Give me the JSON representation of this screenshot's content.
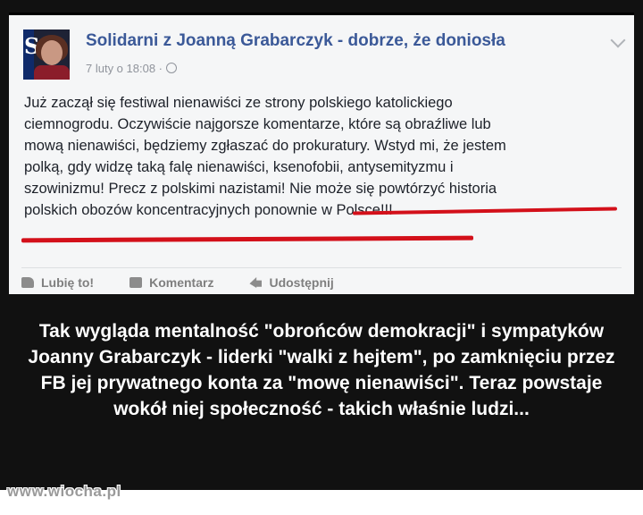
{
  "post": {
    "page_name": "Solidarni z Joanną Grabarczyk - dobrze, że doniosła",
    "timestamp": "7 lutу o 18:08 ·",
    "lines": [
      "Już zaczął się festiwal nienawiści ze strony polskiego katolickiego",
      "ciemnogrodu. Oczywiście najgorsze komentarze, które są obraźliwe lub",
      "mową nienawiści, będziemy zgłaszać do prokuratury. Wstyd mi, że jestem",
      "polką, gdy widzę taką falę nienawiści, ksenofobii, antysemityzmu i",
      "szowinizmu! Precz z polskimi nazistami! Nie może się powtórzyć historia",
      "polskich obozów koncentracyjnych ponownie w Polsce!!!"
    ],
    "actions": {
      "like": "Lubię to!",
      "comment": "Komentarz",
      "share": "Udostępnij"
    },
    "avatar_letter": "S",
    "highlight_color": "#d3101a",
    "link_color": "#3b5998"
  },
  "caption": "Tak wygląda mentalność \"obrońców demokracji\" i sympatyków Joanny Grabarczyk - liderki \"walki z hejtem\", po zamknięciu przez FB jej prywatnego konta za \"mowę nienawiści\". Teraz powstaje wokół niej społeczność - takich właśnie ludzi...",
  "watermark": "www.wiocha.pl"
}
